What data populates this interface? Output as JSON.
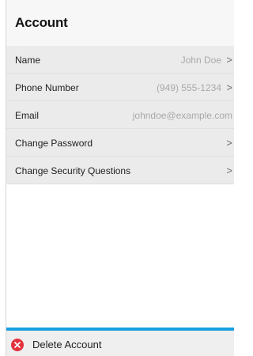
{
  "header": {
    "title": "Account"
  },
  "rows": [
    {
      "label": "Name",
      "value": "John Doe",
      "chevron": ">"
    },
    {
      "label": "Phone Number",
      "value": "(949) 555-1234",
      "chevron": ">"
    },
    {
      "label": "Email",
      "value": "johndoe@example.com",
      "chevron": ""
    },
    {
      "label": "Change Password",
      "value": "",
      "chevron": ">"
    },
    {
      "label": "Change Security Questions",
      "value": "",
      "chevron": ">"
    }
  ],
  "footer": {
    "delete_label": "Delete Account",
    "icon": "x-circle-icon"
  },
  "colors": {
    "accent": "#1a9fe2",
    "danger": "#e3323d",
    "row_bg": "#ebebeb",
    "value_text": "#a9a9a9"
  }
}
